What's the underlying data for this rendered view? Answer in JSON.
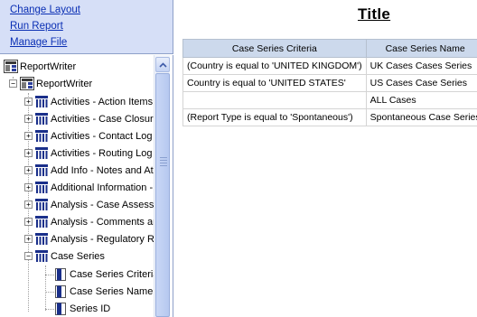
{
  "links": [
    {
      "label": "Change Layout"
    },
    {
      "label": "Run Report"
    },
    {
      "label": "Manage File"
    }
  ],
  "tree": {
    "root_label": "ReportWriter",
    "child_label": "ReportWriter",
    "tables": [
      {
        "label": "Activities - Action Items",
        "expander": "+"
      },
      {
        "label": "Activities - Case Closure",
        "expander": "+"
      },
      {
        "label": "Activities - Contact Log",
        "expander": "+"
      },
      {
        "label": "Activities - Routing Log",
        "expander": "+"
      },
      {
        "label": "Add Info - Notes and At",
        "expander": "+"
      },
      {
        "label": "Additional Information -",
        "expander": "+"
      },
      {
        "label": "Analysis - Case Assessm",
        "expander": "+"
      },
      {
        "label": "Analysis - Comments and",
        "expander": "+"
      },
      {
        "label": "Analysis - Regulatory Re",
        "expander": "+"
      },
      {
        "label": "Case Series",
        "expander": "−"
      }
    ],
    "columns": [
      {
        "label": "Case Series Criteria"
      },
      {
        "label": "Case Series Name"
      },
      {
        "label": "Series ID"
      }
    ]
  },
  "report": {
    "title": "Title",
    "headers": [
      "Case Series Criteria",
      "Case Series Name"
    ],
    "rows": [
      [
        "(Country is equal to 'UNITED KINGDOM')",
        "UK Cases Cases Series"
      ],
      [
        "Country is equal to 'UNITED STATES'",
        "US Cases Case Series"
      ],
      [
        "",
        "ALL Cases"
      ],
      [
        "(Report Type is equal to 'Spontaneous')",
        "Spontaneous Case Series"
      ]
    ]
  },
  "colors": {
    "link": "#0a2fb4",
    "panel_bg": "#d6dff7",
    "header_bg": "#ccd9ec",
    "table_icon": "#1a2f8a"
  }
}
